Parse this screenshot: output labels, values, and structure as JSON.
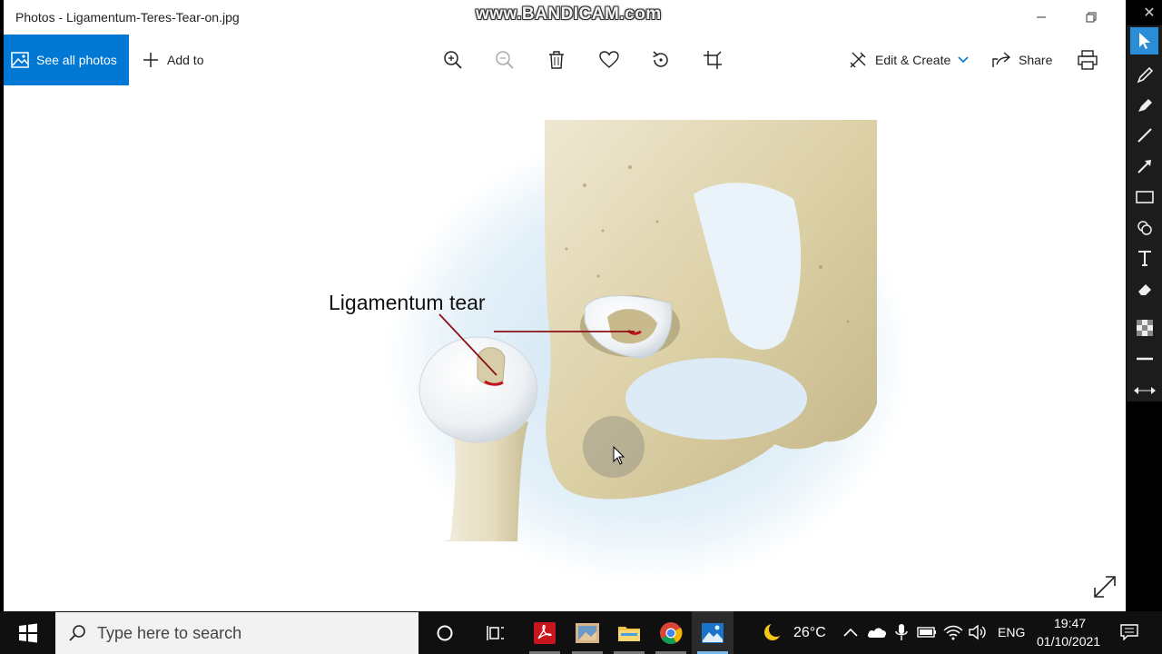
{
  "window": {
    "title": "Photos - Ligamentum-Teres-Tear-on.jpg",
    "watermark": "www.BANDICAM.com"
  },
  "toolbar": {
    "see_all_photos": "See all photos",
    "add_to": "Add to",
    "edit_create": "Edit & Create",
    "share": "Share",
    "icons": [
      "zoom-in-icon",
      "zoom-out-icon",
      "delete-icon",
      "favorite-icon",
      "rotate-icon",
      "crop-icon",
      "print-icon"
    ]
  },
  "image": {
    "annotation_label": "Ligamentum tear",
    "accent_color": "#c0121a"
  },
  "taskbar": {
    "search_placeholder": "Type here to search",
    "weather_temp": "26°C",
    "language": "ENG",
    "time": "19:47",
    "date": "01/10/2021"
  },
  "colors": {
    "accent": "#0078d4",
    "taskbar": "#101010"
  }
}
